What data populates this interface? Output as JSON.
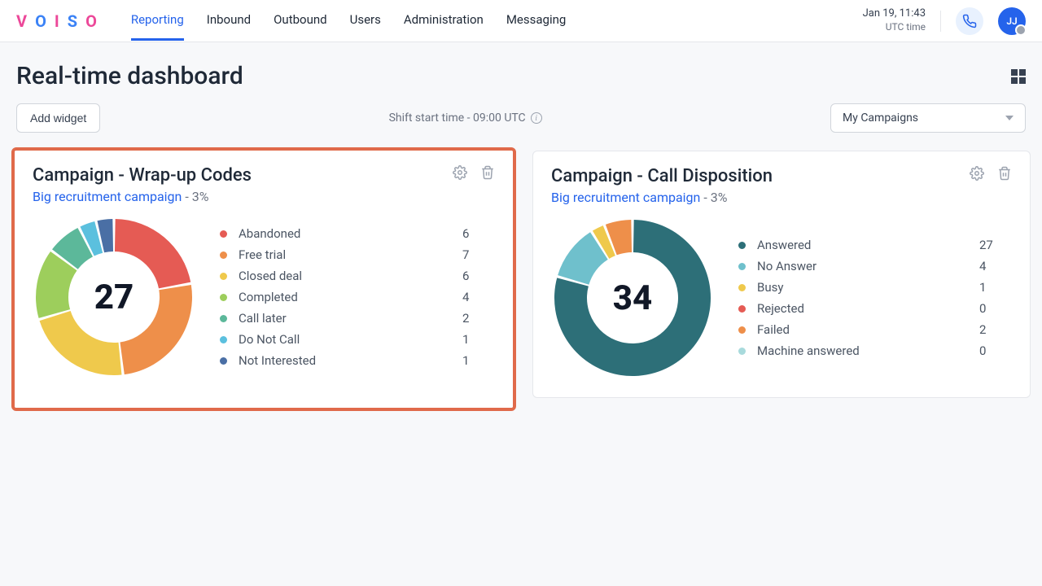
{
  "header": {
    "nav": [
      "Reporting",
      "Inbound",
      "Outbound",
      "Users",
      "Administration",
      "Messaging"
    ],
    "active_index": 0,
    "date": "Jan 19, 11:43",
    "tz": "UTC time",
    "avatar_initials": "JJ"
  },
  "page": {
    "title": "Real-time dashboard",
    "add_widget_label": "Add widget",
    "shift_label": "Shift start time - 09:00 UTC",
    "campaign_select": "My Campaigns"
  },
  "widgets": [
    {
      "title": "Campaign - Wrap-up Codes",
      "subtitle_link": "Big recruitment campaign",
      "subtitle_suffix": " - 3%",
      "center_value": "27",
      "legend": [
        {
          "label": "Abandoned",
          "value": "6",
          "color": "#e55b54"
        },
        {
          "label": "Free trial",
          "value": "7",
          "color": "#ee8f4a"
        },
        {
          "label": "Closed deal",
          "value": "6",
          "color": "#efc94c"
        },
        {
          "label": "Completed",
          "value": "4",
          "color": "#9dce5c"
        },
        {
          "label": "Call later",
          "value": "2",
          "color": "#5cb89a"
        },
        {
          "label": "Do Not Call",
          "value": "1",
          "color": "#5bc0de"
        },
        {
          "label": "Not Interested",
          "value": "1",
          "color": "#4a6fa5"
        }
      ]
    },
    {
      "title": "Campaign - Call Disposition",
      "subtitle_link": "Big recruitment campaign",
      "subtitle_suffix": " - 3%",
      "center_value": "34",
      "legend": [
        {
          "label": "Answered",
          "value": "27",
          "color": "#2d6f78"
        },
        {
          "label": "No Answer",
          "value": "4",
          "color": "#6fc0cc"
        },
        {
          "label": "Busy",
          "value": "1",
          "color": "#efc94c"
        },
        {
          "label": "Rejected",
          "value": "0",
          "color": "#e55b54"
        },
        {
          "label": "Failed",
          "value": "2",
          "color": "#ee8f4a"
        },
        {
          "label": "Machine answered",
          "value": "0",
          "color": "#a8dadc"
        }
      ]
    }
  ],
  "chart_data": [
    {
      "type": "pie",
      "title": "Campaign - Wrap-up Codes",
      "total": 27,
      "series": [
        {
          "name": "Abandoned",
          "value": 6
        },
        {
          "name": "Free trial",
          "value": 7
        },
        {
          "name": "Closed deal",
          "value": 6
        },
        {
          "name": "Completed",
          "value": 4
        },
        {
          "name": "Call later",
          "value": 2
        },
        {
          "name": "Do Not Call",
          "value": 1
        },
        {
          "name": "Not Interested",
          "value": 1
        }
      ]
    },
    {
      "type": "pie",
      "title": "Campaign - Call Disposition",
      "total": 34,
      "series": [
        {
          "name": "Answered",
          "value": 27
        },
        {
          "name": "No Answer",
          "value": 4
        },
        {
          "name": "Busy",
          "value": 1
        },
        {
          "name": "Rejected",
          "value": 0
        },
        {
          "name": "Failed",
          "value": 2
        },
        {
          "name": "Machine answered",
          "value": 0
        }
      ]
    }
  ]
}
